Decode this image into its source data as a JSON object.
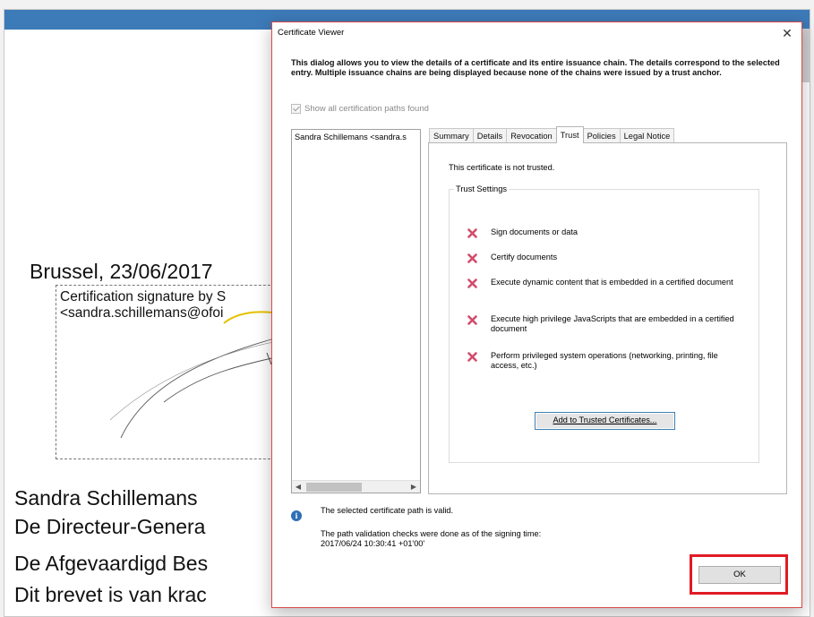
{
  "document": {
    "date_line": "Brussel, 23/06/2017",
    "sig_line1": "Certification signature by S",
    "sig_line2": "<sandra.schillemans@ofoi",
    "name": "Sandra Schillemans",
    "line2": "De Directeur-Genera",
    "line3": "De Afgevaardigd Bes",
    "line4": "Dit brevet is van krac"
  },
  "dialog": {
    "title": "Certificate Viewer",
    "close_symbol": "✕",
    "description": "This dialog allows you to view the details of a certificate and its entire issuance chain. The details correspond to the selected entry. Multiple issuance chains are being displayed because none of the chains were issued by a trust anchor.",
    "show_all_label": "Show all certification paths found",
    "tree": {
      "items": [
        "Sandra Schillemans <sandra.s"
      ]
    },
    "tabs": [
      {
        "label": "Summary",
        "active": false
      },
      {
        "label": "Details",
        "active": false
      },
      {
        "label": "Revocation",
        "active": false
      },
      {
        "label": "Trust",
        "active": true
      },
      {
        "label": "Policies",
        "active": false
      },
      {
        "label": "Legal Notice",
        "active": false
      }
    ],
    "trust": {
      "status": "This certificate is not trusted.",
      "group_label": "Trust Settings",
      "permissions": [
        "Sign documents or data",
        "Certify documents",
        "Execute dynamic content that is embedded in a certified document",
        "Execute high privilege JavaScripts that are embedded in a certified document",
        "Perform privileged system operations (networking, printing, file access, etc.)"
      ],
      "add_button": "Add to Trusted Certificates..."
    },
    "info": {
      "valid": "The selected certificate path is valid.",
      "check_line1": "The path validation checks were done as of the signing time:",
      "check_line2": "2017/06/24 10:30:41 +01'00'"
    },
    "ok_label": "OK"
  },
  "colors": {
    "accent_blue": "#3d7ab8",
    "x_icon": "#d24b6a",
    "highlight_red": "#e01b24"
  },
  "icons": {
    "deny": "x-mark-icon",
    "info": "info-icon",
    "close": "close-icon"
  }
}
